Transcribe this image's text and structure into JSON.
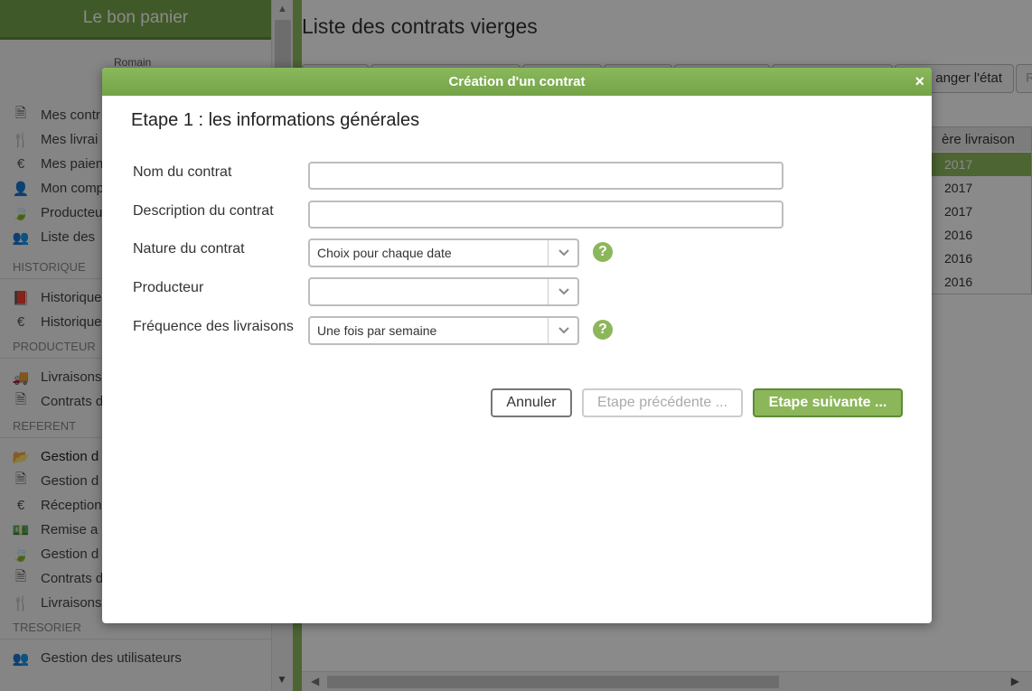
{
  "sidebar": {
    "brand": "Le bon panier",
    "user_name": "Romain",
    "groups": [
      {
        "title": "",
        "items": [
          {
            "icon": "file-icon",
            "glyph": "🗎",
            "label": "Mes contr"
          },
          {
            "icon": "cutlery-icon",
            "glyph": "🍴",
            "label": "Mes livrai"
          },
          {
            "icon": "euro-icon",
            "glyph": "€",
            "label": "Mes paien"
          },
          {
            "icon": "user-icon",
            "glyph": "👤",
            "label": "Mon comp"
          },
          {
            "icon": "leaf-icon",
            "glyph": "🍃",
            "label": "Producteu"
          },
          {
            "icon": "users-icon",
            "glyph": "👥",
            "label": "Liste des"
          }
        ]
      },
      {
        "title": "HISTORIQUE",
        "items": [
          {
            "icon": "book-icon",
            "glyph": "📕",
            "label": "Historique"
          },
          {
            "icon": "euro-icon",
            "glyph": "€",
            "label": "Historique"
          }
        ]
      },
      {
        "title": "PRODUCTEUR",
        "items": [
          {
            "icon": "truck-icon",
            "glyph": "🚚",
            "label": "Livraisons"
          },
          {
            "icon": "file-icon",
            "glyph": "🗎",
            "label": "Contrats d"
          }
        ]
      },
      {
        "title": "REFERENT",
        "items": [
          {
            "icon": "folder-open-icon",
            "glyph": "📂",
            "label": "Gestion d",
            "active": true
          },
          {
            "icon": "file-icon",
            "glyph": "🗎",
            "label": "Gestion d"
          },
          {
            "icon": "euro-icon",
            "glyph": "€",
            "label": "Réception"
          },
          {
            "icon": "money-icon",
            "glyph": "💵",
            "label": "Remise a"
          },
          {
            "icon": "leaf-icon",
            "glyph": "🍃",
            "label": "Gestion d"
          },
          {
            "icon": "file-icon",
            "glyph": "🗎",
            "label": "Contrats d"
          },
          {
            "icon": "cutlery-icon",
            "glyph": "🍴",
            "label": "Livraisons"
          }
        ]
      },
      {
        "title": "TRESORIER",
        "items": [
          {
            "icon": "users-icon",
            "glyph": "👥",
            "label": "Gestion des utilisateurs"
          }
        ]
      }
    ]
  },
  "main": {
    "title": "Liste des contrats vierges",
    "toolbar": {
      "change_state_label": "anger l'état",
      "extra_label": "R"
    },
    "grid": {
      "column_header": "ère livraison",
      "rows": [
        "2017",
        "2017",
        "2017",
        "2016",
        "2016",
        "2016"
      ]
    }
  },
  "modal": {
    "title": "Création d'un contrat",
    "close_glyph": "×",
    "step_title": "Etape 1 : les informations générales",
    "fields": {
      "name": {
        "label": "Nom du contrat",
        "value": ""
      },
      "description": {
        "label": "Description du contrat",
        "value": ""
      },
      "nature": {
        "label": "Nature du contrat",
        "value": "Choix pour chaque date"
      },
      "producer": {
        "label": "Producteur",
        "value": ""
      },
      "frequency": {
        "label": "Fréquence des livraisons",
        "value": "Une fois par semaine"
      }
    },
    "help_glyph": "?",
    "buttons": {
      "cancel": "Annuler",
      "previous": "Etape précédente ...",
      "next": "Etape suivante ..."
    }
  },
  "colors": {
    "accent": "#77a54a",
    "accent_dark": "#5e8a38",
    "selection": "#8fba5e"
  }
}
